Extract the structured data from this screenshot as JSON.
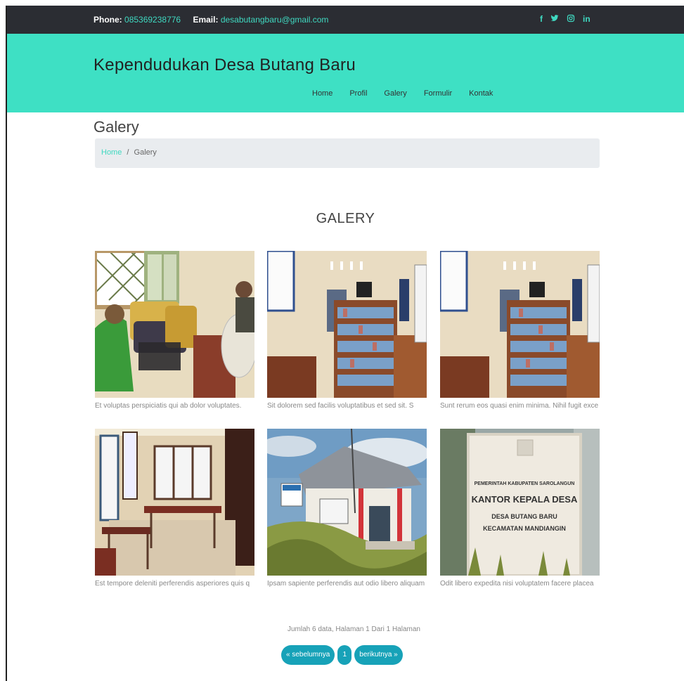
{
  "topbar": {
    "phone_label": "Phone:",
    "phone_value": "085369238776",
    "email_label": "Email:",
    "email_value": "desabutangbaru@gmail.com",
    "social": [
      "f",
      "t",
      "ig",
      "in"
    ]
  },
  "header": {
    "brand": "Kependudukan Desa Butang Baru",
    "nav": [
      "Home",
      "Profil",
      "Galery",
      "Formulir",
      "Kontak"
    ]
  },
  "page": {
    "title": "Galery",
    "breadcrumb": {
      "home": "Home",
      "separator": "/",
      "current": "Galery"
    },
    "section_title": "GALERY"
  },
  "gallery": [
    {
      "caption": "Et voluptas perspiciatis qui ab dolor voluptates."
    },
    {
      "caption": "Sit dolorem sed facilis voluptatibus et sed sit. S"
    },
    {
      "caption": "Sunt rerum eos quasi enim minima. Nihil fugit exce"
    },
    {
      "caption": "Est tempore deleniti perferendis asperiores quis q"
    },
    {
      "caption": "Ipsam sapiente perferendis aut odio libero aliquam"
    },
    {
      "caption": "Odit libero expedita nisi voluptatem facere placea"
    }
  ],
  "sign_text": {
    "line1": "PEMERINTAH KABUPATEN SAROLANGUN",
    "line2": "KANTOR KEPALA DESA",
    "line3": "DESA BUTANG BARU",
    "line4": "KECAMATAN MANDIANGIN"
  },
  "pagination": {
    "info": "Jumlah 6 data, Halaman 1 Dari 1 Halaman",
    "prev": "« sebelumnya",
    "page": "1",
    "next": "berikutnya »"
  },
  "colors": {
    "accent": "#3ee0c4",
    "topbar": "#2b2d33",
    "button": "#17a2b8"
  }
}
